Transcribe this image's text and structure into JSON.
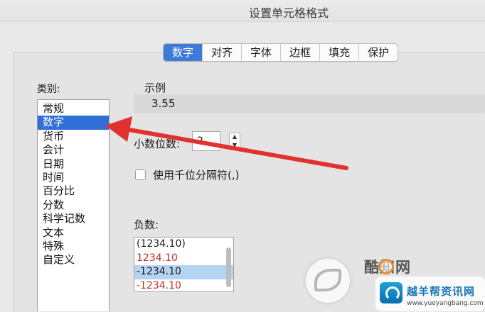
{
  "window": {
    "title": "设置单元格格式"
  },
  "tabs": [
    {
      "label": "数字",
      "active": true
    },
    {
      "label": "对齐",
      "active": false
    },
    {
      "label": "字体",
      "active": false
    },
    {
      "label": "边框",
      "active": false
    },
    {
      "label": "填充",
      "active": false
    },
    {
      "label": "保护",
      "active": false
    }
  ],
  "category": {
    "label": "类别:",
    "selected": "数字",
    "items": [
      "常规",
      "数字",
      "货币",
      "会计",
      "日期",
      "时间",
      "百分比",
      "分数",
      "科学记数",
      "文本",
      "特殊",
      "自定义"
    ]
  },
  "sample": {
    "label": "示例",
    "value": "3.55"
  },
  "decimal": {
    "label": "小数位数:",
    "value": "2"
  },
  "thousands": {
    "label": "使用千位分隔符(,)",
    "checked": false
  },
  "negative": {
    "label": "负数:",
    "items": [
      {
        "text": "(1234.10)",
        "color": "#222222",
        "selected": false
      },
      {
        "text": "1234.10",
        "color": "#c0302c",
        "selected": false
      },
      {
        "text": "-1234.10",
        "color": "#222222",
        "selected": true
      },
      {
        "text": "-1234.10",
        "color": "#c0302c",
        "selected": false
      }
    ]
  },
  "annotation": {
    "arrow_color": "#e0322e"
  },
  "watermark": {
    "text1": "酷知网",
    "text2": "越羊帮资讯网",
    "url": "www.yueyangbang.com"
  },
  "colors": {
    "accent": "#3f7ad6",
    "selection": "#2f6fd6",
    "negative_red": "#c0302c"
  }
}
